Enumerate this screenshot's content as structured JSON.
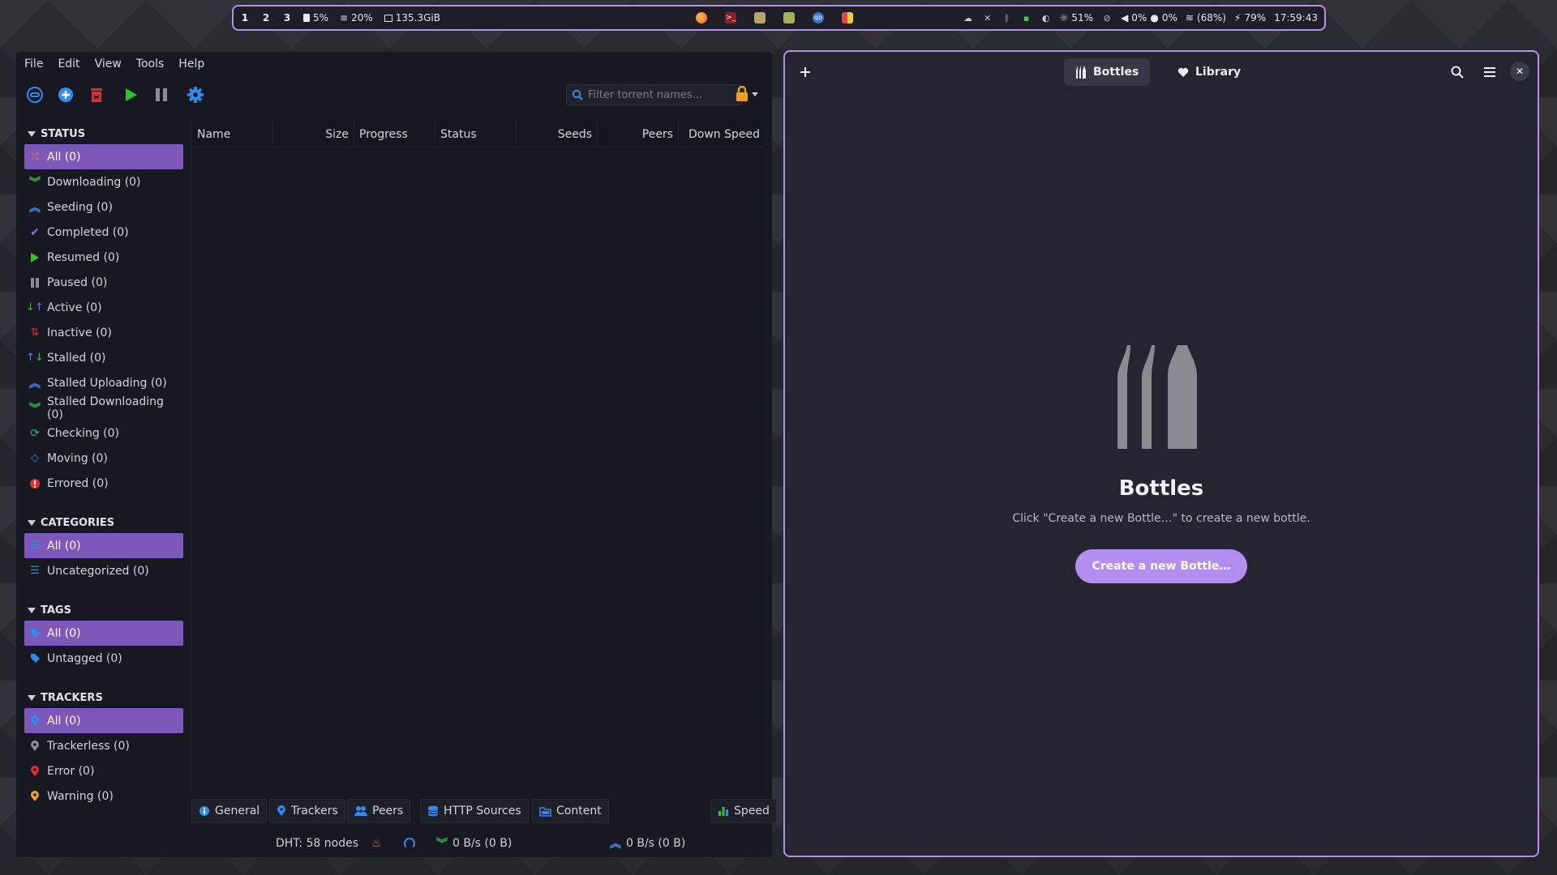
{
  "topbar": {
    "workspaces": [
      "1",
      "2",
      "3"
    ],
    "cpu": "5%",
    "memory": "20%",
    "disk": "135.3GiB",
    "brightness": "51%",
    "volume": "0%",
    "mic": "0%",
    "wifi": "(68%)",
    "battery": "79%",
    "clock": "17:59:43",
    "colors": {
      "border": "#b690e8",
      "background": "#1e1f26"
    }
  },
  "qbt": {
    "menu": [
      "File",
      "Edit",
      "View",
      "Tools",
      "Help"
    ],
    "filter_placeholder": "Filter torrent names...",
    "sections": {
      "status": {
        "title": "STATUS",
        "items": [
          {
            "label": "All (0)",
            "icon": "shuffle-icon"
          },
          {
            "label": "Downloading (0)",
            "icon": "download-chevrons-icon"
          },
          {
            "label": "Seeding (0)",
            "icon": "upload-chevrons-icon"
          },
          {
            "label": "Completed (0)",
            "icon": "checkmark-icon"
          },
          {
            "label": "Resumed (0)",
            "icon": "play-icon"
          },
          {
            "label": "Paused (0)",
            "icon": "pause-icon"
          },
          {
            "label": "Active (0)",
            "icon": "active-arrows-icon"
          },
          {
            "label": "Inactive (0)",
            "icon": "inactive-arrows-icon"
          },
          {
            "label": "Stalled (0)",
            "icon": "stalled-arrows-icon"
          },
          {
            "label": "Stalled Uploading (0)",
            "icon": "stalled-upload-icon"
          },
          {
            "label": "Stalled Downloading (0)",
            "icon": "stalled-download-icon"
          },
          {
            "label": "Checking (0)",
            "icon": "refresh-icon"
          },
          {
            "label": "Moving (0)",
            "icon": "diamond-icon"
          },
          {
            "label": "Errored (0)",
            "icon": "error-icon"
          }
        ]
      },
      "categories": {
        "title": "CATEGORIES",
        "items": [
          {
            "label": "All (0)",
            "icon": "list-icon"
          },
          {
            "label": "Uncategorized (0)",
            "icon": "list-icon"
          }
        ]
      },
      "tags": {
        "title": "TAGS",
        "items": [
          {
            "label": "All (0)",
            "icon": "tag-icon"
          },
          {
            "label": "Untagged (0)",
            "icon": "tag-icon"
          }
        ]
      },
      "trackers": {
        "title": "TRACKERS",
        "items": [
          {
            "label": "All (0)",
            "icon": "pin-icon"
          },
          {
            "label": "Trackerless (0)",
            "icon": "pin-icon"
          },
          {
            "label": "Error (0)",
            "icon": "pin-icon"
          },
          {
            "label": "Warning (0)",
            "icon": "pin-icon"
          }
        ]
      }
    },
    "columns": [
      "Name",
      "Size",
      "Progress",
      "Status",
      "Seeds",
      "Peers",
      "Down Speed"
    ],
    "tabs": [
      "General",
      "Trackers",
      "Peers",
      "HTTP Sources",
      "Content",
      "Speed"
    ],
    "statusbar": {
      "dht": "DHT: 58 nodes",
      "down": "0 B/s (0 B)",
      "up": "0 B/s (0 B)"
    },
    "colors": {
      "selected": "#7e58b8",
      "accent_blue": "#2f8cf0"
    }
  },
  "bottles": {
    "tabs": [
      "Bottles",
      "Library"
    ],
    "empty_title": "Bottles",
    "empty_desc": "Click \"Create a new Bottle…\" to create a new bottle.",
    "create_label": "Create a new Bottle…",
    "colors": {
      "button": "#b38ef0",
      "border": "#b690e8"
    }
  }
}
